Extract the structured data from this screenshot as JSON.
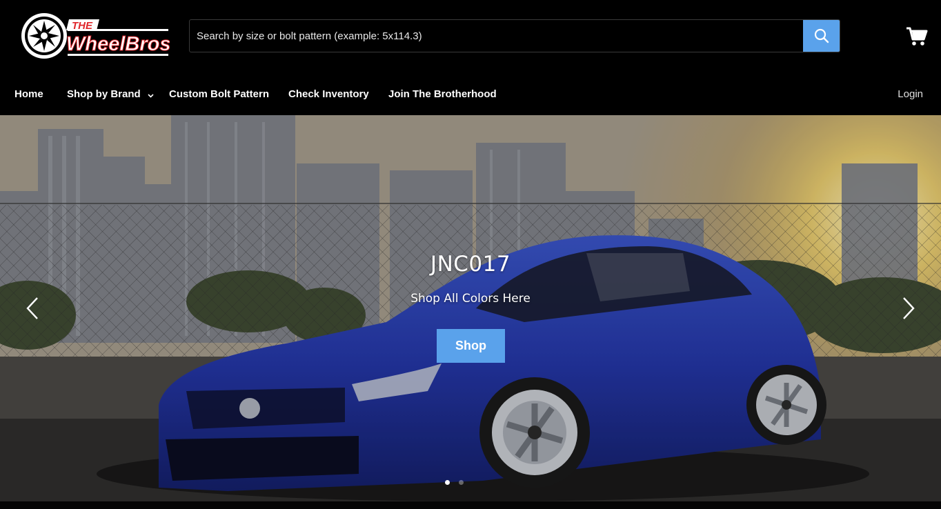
{
  "brand": {
    "logo_line1": "THE",
    "logo_line2": "WheelBros",
    "accent_red": "#e0262b",
    "accent_blue": "#5aa2eb"
  },
  "search": {
    "placeholder": "Search by size or bolt pattern (example: 5x114.3)",
    "value": "",
    "button_icon": "search-icon"
  },
  "cart": {
    "icon": "cart-icon"
  },
  "nav": {
    "items": [
      {
        "label": "Home"
      },
      {
        "label": "Shop by Brand",
        "has_dropdown": true
      },
      {
        "label": "Custom Bolt Pattern"
      },
      {
        "label": "Check Inventory"
      },
      {
        "label": "Join The Brotherhood"
      }
    ],
    "login_label": "Login"
  },
  "hero": {
    "title": "JNC017",
    "subtitle": "Shop All Colors Here",
    "button_label": "Shop",
    "prev_icon": "chevron-left-icon",
    "next_icon": "chevron-right-icon",
    "slide_count": 2,
    "active_slide": 1
  }
}
